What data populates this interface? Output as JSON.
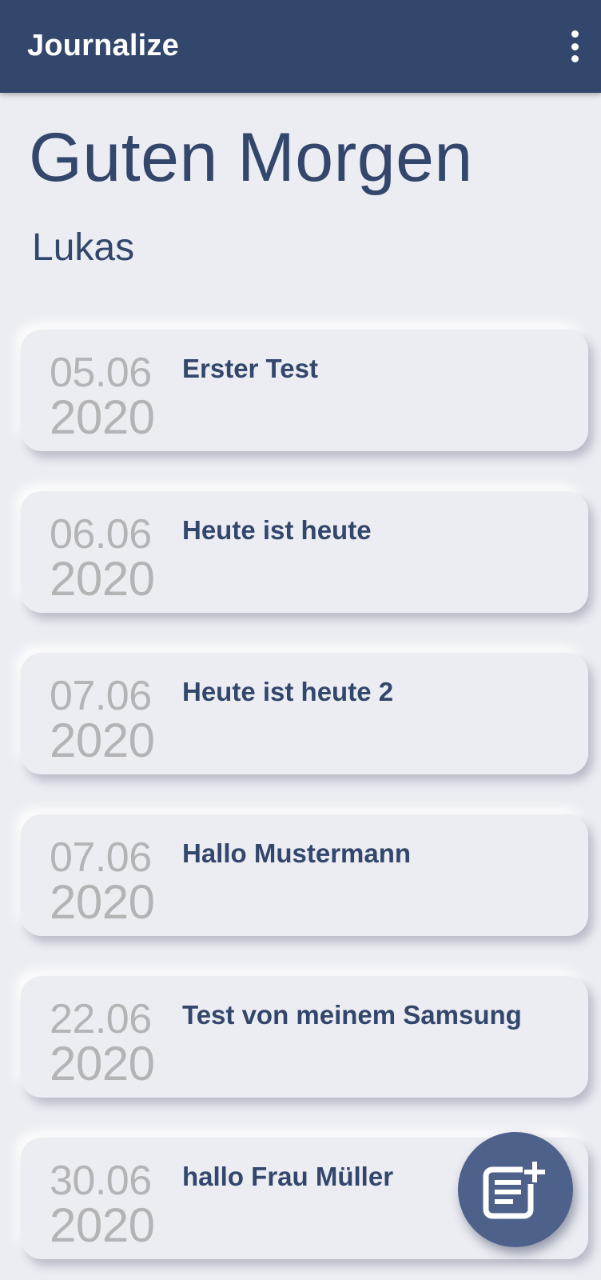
{
  "appbar": {
    "title": "Journalize",
    "menu_icon": "more-vert-icon"
  },
  "header": {
    "greeting": "Guten Morgen",
    "username": "Lukas"
  },
  "entries": [
    {
      "day": "05.06",
      "year": "2020",
      "title": "Erster Test"
    },
    {
      "day": "06.06",
      "year": "2020",
      "title": "Heute ist heute"
    },
    {
      "day": "07.06",
      "year": "2020",
      "title": "Heute ist heute 2"
    },
    {
      "day": "07.06",
      "year": "2020",
      "title": "Hallo Mustermann"
    },
    {
      "day": "22.06",
      "year": "2020",
      "title": "Test von meinem Samsung"
    },
    {
      "day": "30.06",
      "year": "2020",
      "title": "hallo Frau Müller"
    }
  ],
  "fab": {
    "icon": "add-note-icon"
  },
  "colors": {
    "primary": "#33466b",
    "background": "#ecedf3",
    "date_text": "#b4b4b7",
    "fab": "#4e618a"
  }
}
